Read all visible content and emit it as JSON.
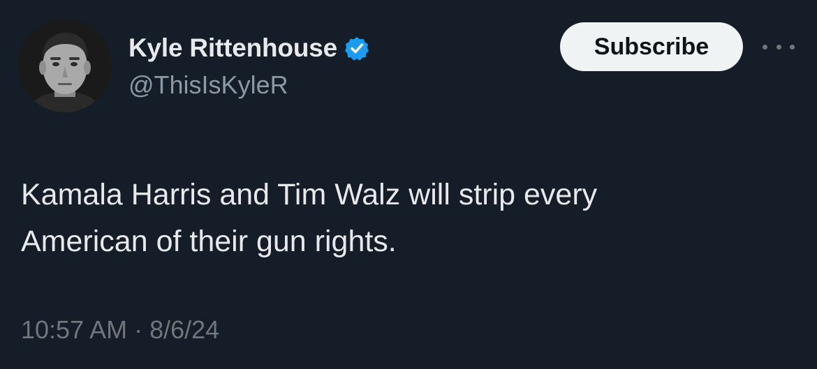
{
  "tweet": {
    "author": {
      "display_name": "Kyle Rittenhouse",
      "handle": "@ThisIsKyleR",
      "verified_icon": "verified-badge-icon",
      "avatar_icon": "profile-photo"
    },
    "actions": {
      "subscribe_label": "Subscribe",
      "more_icon": "more-options-icon"
    },
    "text": "Kamala Harris and Tim Walz will strip every\nAmerican of their gun rights.",
    "time": "10:57 AM",
    "separator": "·",
    "date": "8/6/24"
  },
  "colors": {
    "background": "#151d28",
    "primary_text": "#e7e9ea",
    "secondary_text": "#8b98a5",
    "verified_blue": "#1d9bf0",
    "button_bg": "#eff3f4"
  }
}
